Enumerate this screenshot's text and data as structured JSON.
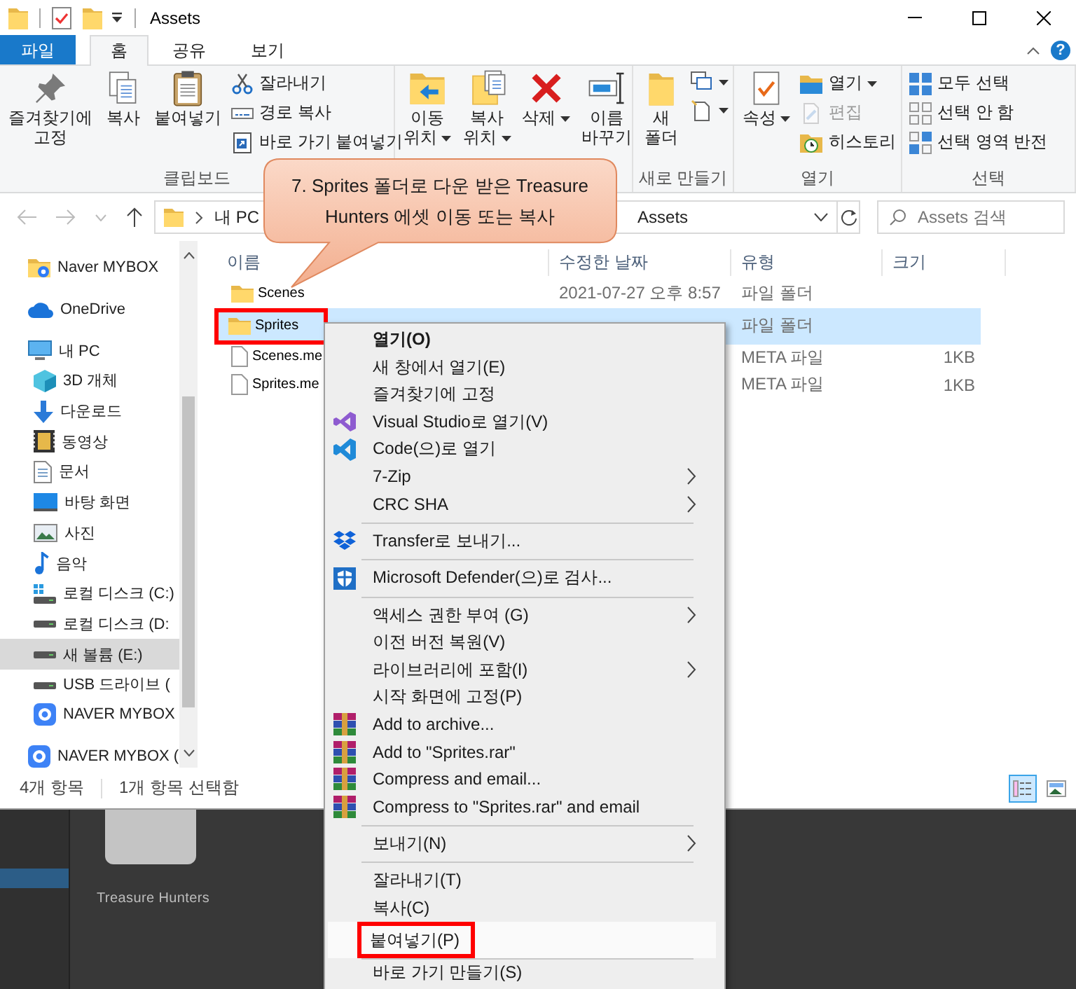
{
  "window": {
    "title": "Assets"
  },
  "ribbon": {
    "tabs": [
      {
        "label": "파일",
        "kind": "file",
        "selected": false
      },
      {
        "label": "홈",
        "kind": "tab",
        "selected": true
      },
      {
        "label": "공유",
        "kind": "tab",
        "selected": false
      },
      {
        "label": "보기",
        "kind": "tab",
        "selected": false
      }
    ],
    "help": "?",
    "groups": [
      {
        "label": "클립보드",
        "large": [
          {
            "label": "즐겨찾기에\n고정",
            "dropdown": false
          },
          {
            "label": "복사",
            "dropdown": false
          },
          {
            "label": "붙여넣기",
            "dropdown": false
          }
        ],
        "small": [
          {
            "label": "잘라내기",
            "dropdown": false,
            "disabled": false
          },
          {
            "label": "경로 복사",
            "dropdown": false,
            "disabled": false
          },
          {
            "label": "바로 가기 붙여넣기",
            "dropdown": false,
            "disabled": false
          }
        ]
      },
      {
        "large": [
          {
            "label": "이동\n위치",
            "dropdown": true
          },
          {
            "label": "복사\n위치",
            "dropdown": true
          },
          {
            "label": "삭제",
            "dropdown": true
          },
          {
            "label": "이름\n바꾸기",
            "dropdown": false
          }
        ]
      },
      {
        "label": "새로 만들기",
        "large": [
          {
            "label": "새\n폴더",
            "dropdown": false
          }
        ],
        "small": [
          {
            "dropdown": true,
            "disabled": false
          },
          {
            "dropdown": true,
            "disabled": false
          }
        ]
      },
      {
        "label": "열기",
        "large": [
          {
            "label": "속성",
            "dropdown": true
          }
        ],
        "small": [
          {
            "label": "열기",
            "dropdown": true,
            "disabled": false
          },
          {
            "label": "편집",
            "dropdown": false,
            "disabled": true
          },
          {
            "label": "히스토리",
            "dropdown": false,
            "disabled": false
          }
        ]
      },
      {
        "label": "선택",
        "small": [
          {
            "label": "모두 선택",
            "dropdown": false,
            "disabled": false
          },
          {
            "label": "선택 안 함",
            "dropdown": false,
            "disabled": false
          },
          {
            "label": "선택 영역 반전",
            "dropdown": false,
            "disabled": false
          }
        ]
      }
    ]
  },
  "address": {
    "segments": [
      {
        "label": "내 PC"
      },
      {
        "label": "Assets"
      }
    ],
    "search": {
      "placeholder": "Assets 검색"
    }
  },
  "nav": {
    "items": [
      {
        "label": "Naver MYBOX",
        "kind": "mybox-folder",
        "selected": false
      },
      {
        "label": "OneDrive",
        "kind": "cloud",
        "selected": false
      },
      {
        "label": "내 PC",
        "kind": "pc",
        "selected": false,
        "children": [
          {
            "label": "3D 개체",
            "kind": "cube",
            "selected": false
          },
          {
            "label": "다운로드",
            "kind": "download",
            "selected": false
          },
          {
            "label": "동영상",
            "kind": "video",
            "selected": false
          },
          {
            "label": "문서",
            "kind": "document",
            "selected": false
          },
          {
            "label": "바탕 화면",
            "kind": "desktop",
            "selected": false
          },
          {
            "label": "사진",
            "kind": "photo",
            "selected": false
          },
          {
            "label": "음악",
            "kind": "music",
            "selected": false
          },
          {
            "label": "로컬 디스크 (C:)",
            "kind": "system-drive",
            "selected": false
          },
          {
            "label": "로컬 디스크 (D:",
            "kind": "drive",
            "selected": false
          },
          {
            "label": "새 볼륨 (E:)",
            "kind": "drive",
            "selected": true
          },
          {
            "label": "USB 드라이브 (",
            "kind": "drive",
            "selected": false
          },
          {
            "label": "NAVER MYBOX",
            "kind": "mybox",
            "selected": false
          }
        ]
      },
      {
        "label": "NAVER MYBOX (",
        "kind": "mybox",
        "selected": false
      }
    ]
  },
  "files": {
    "columns": [
      "이름",
      "수정한 날짜",
      "유형",
      "크기"
    ],
    "rows": [
      {
        "name": "Scenes",
        "date": "2021-07-27 오후 8:57",
        "type": "파일 폴더",
        "kind": "folder",
        "selected": false,
        "marked": false
      },
      {
        "name": "Sprites",
        "type": "파일 폴더",
        "kind": "folder",
        "selected": true,
        "marked": true
      },
      {
        "name": "Scenes.me",
        "type": "META 파일",
        "size": "1KB",
        "kind": "file",
        "selected": false,
        "marked": false
      },
      {
        "name": "Sprites.me",
        "type": "META 파일",
        "size": "1KB",
        "kind": "file",
        "selected": false,
        "marked": false
      }
    ]
  },
  "status_bar": {
    "items": [
      "4개 항목",
      "1개 항목 선택함"
    ],
    "views": [
      {
        "selected": true
      },
      {
        "selected": false
      }
    ]
  },
  "unity_panel": {
    "project": "Treasure Hunters"
  },
  "callout": {
    "text": "7. Sprites 폴더로 다운 받은 Treasure Hunters 에셋 이동 또는 복사"
  },
  "context_menu": {
    "items": [
      {
        "kind": "default",
        "label": "열기(O)",
        "selected": false,
        "marked": false
      },
      {
        "kind": "item",
        "label": "새 창에서 열기(E)",
        "selected": false,
        "marked": false
      },
      {
        "kind": "item",
        "label": "즐겨찾기에 고정",
        "selected": false,
        "marked": false
      },
      {
        "kind": "vs",
        "label": "Visual Studio로 열기(V)",
        "selected": false,
        "marked": false
      },
      {
        "kind": "code",
        "label": "Code(으)로 열기",
        "selected": false,
        "marked": false
      },
      {
        "kind": "submenu",
        "label": "7-Zip",
        "selected": false,
        "marked": false
      },
      {
        "kind": "submenu",
        "label": "CRC SHA",
        "selected": false,
        "marked": false
      },
      {
        "kind": "separator"
      },
      {
        "kind": "dropbox",
        "label": "Transfer로 보내기...",
        "selected": false,
        "marked": false
      },
      {
        "kind": "separator"
      },
      {
        "kind": "defender",
        "label": "Microsoft Defender(으)로 검사...",
        "selected": false,
        "marked": false
      },
      {
        "kind": "separator"
      },
      {
        "kind": "submenu",
        "label": "액세스 권한 부여 (G)",
        "selected": false,
        "marked": false
      },
      {
        "kind": "item",
        "label": "이전 버전 복원(V)",
        "selected": false,
        "marked": false
      },
      {
        "kind": "submenu",
        "label": "라이브러리에 포함(I)",
        "selected": false,
        "marked": false
      },
      {
        "kind": "item",
        "label": "시작 화면에 고정(P)",
        "selected": false,
        "marked": false
      },
      {
        "kind": "rar",
        "label": "Add to archive...",
        "selected": false,
        "marked": false
      },
      {
        "kind": "rar",
        "label": "Add to \"Sprites.rar\"",
        "selected": false,
        "marked": false
      },
      {
        "kind": "rar",
        "label": "Compress and email...",
        "selected": false,
        "marked": false
      },
      {
        "kind": "rar",
        "label": "Compress to \"Sprites.rar\" and email",
        "selected": false,
        "marked": false
      },
      {
        "kind": "separator"
      },
      {
        "kind": "submenu",
        "label": "보내기(N)",
        "selected": false,
        "marked": false
      },
      {
        "kind": "separator"
      },
      {
        "kind": "item",
        "label": "잘라내기(T)",
        "selected": false,
        "marked": false
      },
      {
        "kind": "item",
        "label": "복사(C)",
        "selected": false,
        "marked": false
      },
      {
        "kind": "item",
        "label": "붙여넣기(P)",
        "selected": true,
        "marked": true
      },
      {
        "kind": "separator"
      },
      {
        "kind": "item",
        "label": "바로 가기 만들기(S)",
        "selected": false,
        "marked": false
      }
    ]
  }
}
